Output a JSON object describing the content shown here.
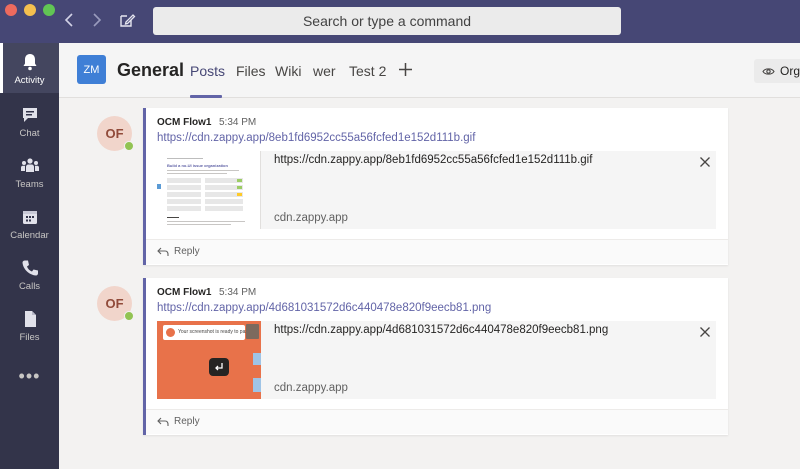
{
  "search": {
    "placeholder": "Search or type a command"
  },
  "rail": {
    "items": [
      {
        "label": "Activity",
        "icon": "bell-icon"
      },
      {
        "label": "Chat",
        "icon": "chat-icon"
      },
      {
        "label": "Teams",
        "icon": "teams-icon"
      },
      {
        "label": "Calendar",
        "icon": "calendar-icon"
      },
      {
        "label": "Calls",
        "icon": "phone-icon"
      },
      {
        "label": "Files",
        "icon": "file-icon"
      }
    ],
    "more": "•••"
  },
  "header": {
    "team_initials": "ZM",
    "channel": "General",
    "tabs": [
      "Posts",
      "Files",
      "Wiki",
      "wer",
      "Test 2"
    ],
    "org_label": "Org"
  },
  "messages": [
    {
      "initials": "OF",
      "author": "OCM Flow1",
      "time": "5:34 PM",
      "link": "https://cdn.zappy.app/8eb1fd6952cc55a56fcfed1e152d111b.gif",
      "preview_title": "https://cdn.zappy.app/8eb1fd6952cc55a56fcfed1e152d111b.gif",
      "preview_domain": "cdn.zappy.app",
      "thumb_heading": "Build a no-UI issue organization",
      "reply_label": "Reply"
    },
    {
      "initials": "OF",
      "author": "OCM Flow1",
      "time": "5:34 PM",
      "link": "https://cdn.zappy.app/4d681031572d6c440478e820f9eecb81.png",
      "preview_title": "https://cdn.zappy.app/4d681031572d6c440478e820f9eecb81.png",
      "preview_domain": "cdn.zappy.app",
      "thumb_notice": "Your screenshot is ready to paste",
      "reply_label": "Reply"
    }
  ],
  "colors": {
    "titlebar": "#464775",
    "rail": "#33344a",
    "accent": "#6264a7",
    "presence": "#92c353"
  }
}
